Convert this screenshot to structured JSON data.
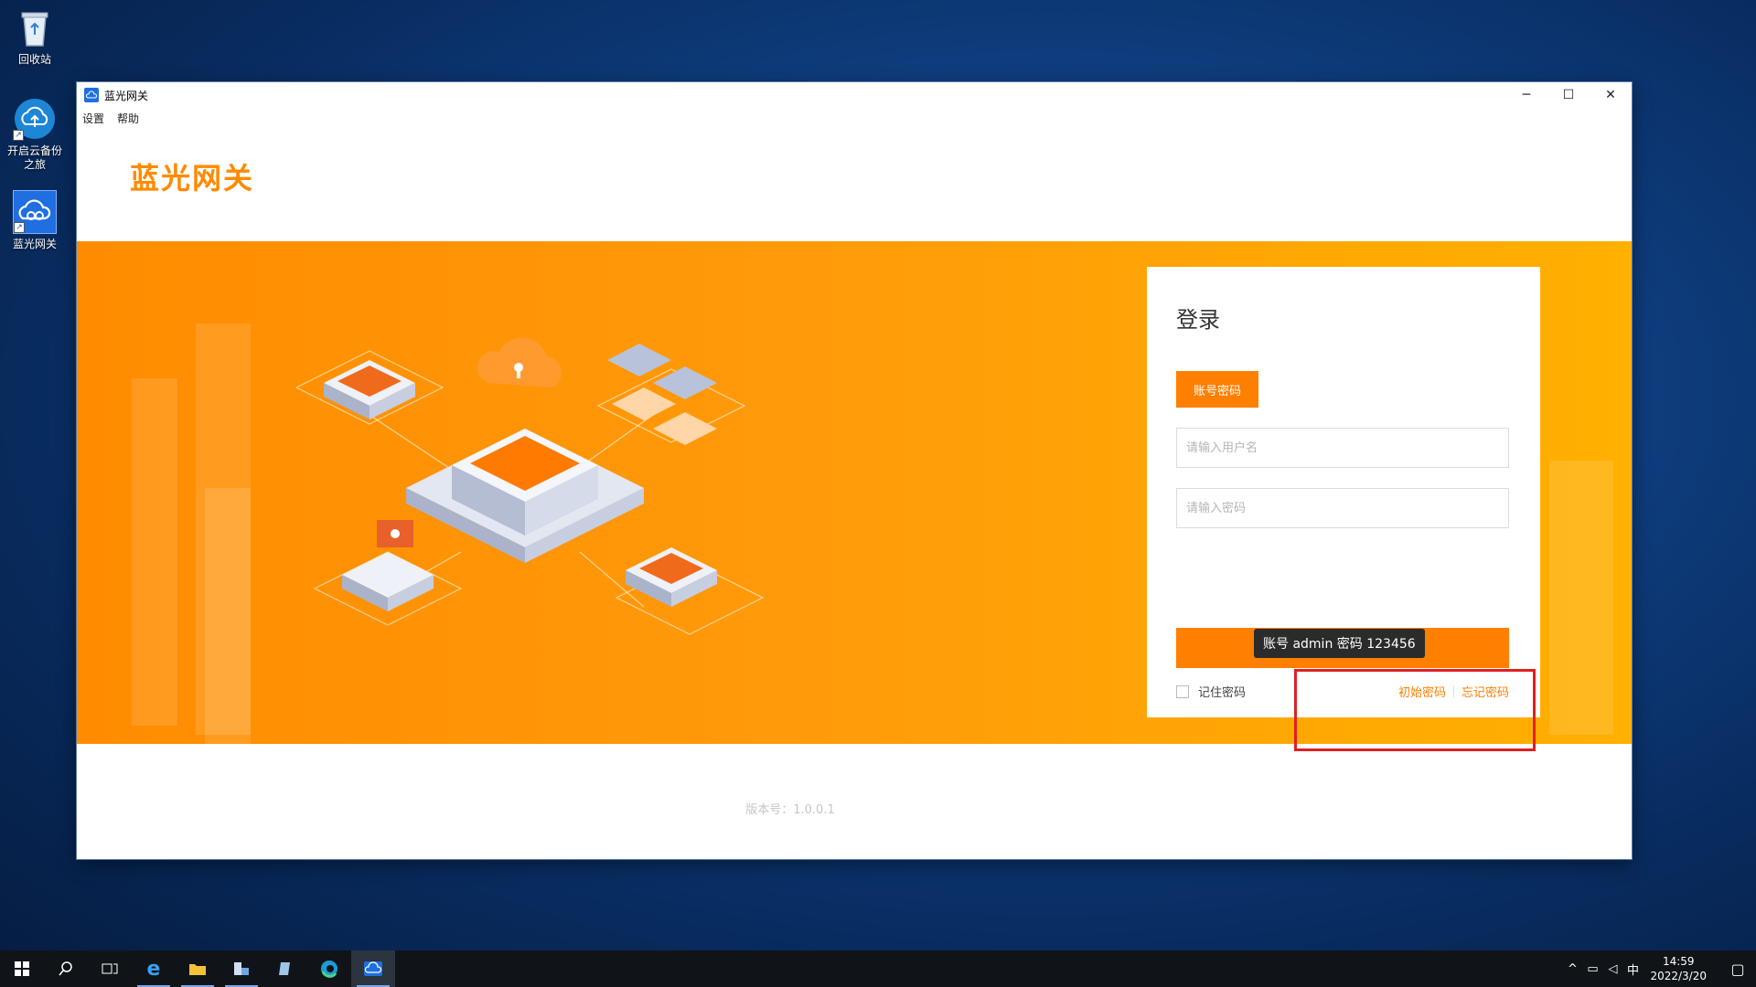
{
  "desktop": {
    "icons": [
      {
        "label": "回收站"
      },
      {
        "label": "开启云备份之旅"
      },
      {
        "label": "蓝光网关"
      }
    ]
  },
  "window": {
    "title": "蓝光网关",
    "controls": {
      "minimize": "─",
      "maximize": "☐",
      "close": "✕"
    },
    "menu": [
      "设置",
      "帮助"
    ],
    "brand": "蓝光网关"
  },
  "login": {
    "title": "登录",
    "tab_label": "账号密码",
    "username_placeholder": "请输入用户名",
    "password_placeholder": "请输入密码",
    "submit_label": "登录",
    "remember_label": "记住密码",
    "initial_password_link": "初始密码",
    "forgot_password_link": "忘记密码",
    "tooltip": "账号 admin 密码 123456"
  },
  "footer": {
    "version": "版本号：1.0.0.1"
  },
  "taskbar": {
    "clock_time": "14:59",
    "clock_date": "2022/3/20",
    "ime": "中"
  },
  "colors": {
    "accent": "#ff7f00",
    "highlight_box": "#e02020"
  }
}
